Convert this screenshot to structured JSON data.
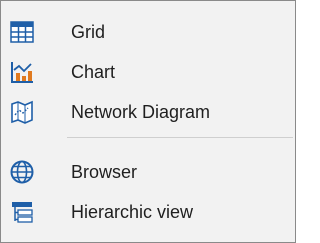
{
  "menu": {
    "items": [
      {
        "label": "Grid",
        "icon": "grid-icon"
      },
      {
        "label": "Chart",
        "icon": "chart-icon"
      },
      {
        "label": "Network Diagram",
        "icon": "network-diagram-icon"
      },
      {
        "label": "Browser",
        "icon": "globe-icon"
      },
      {
        "label": "Hierarchic view",
        "icon": "hierarchy-icon"
      }
    ]
  },
  "colors": {
    "icon_blue": "#1f5fa8",
    "icon_orange": "#e07a1f",
    "background": "#f2f2f2",
    "text": "#1f1f1f"
  }
}
